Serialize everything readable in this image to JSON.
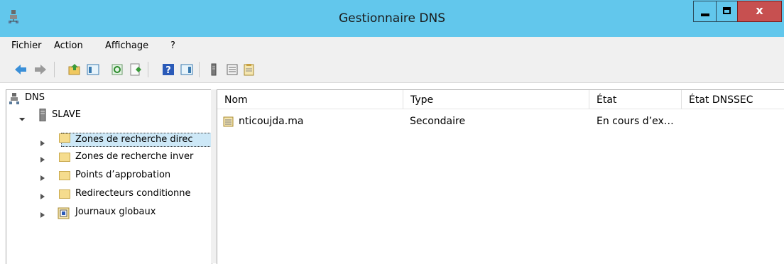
{
  "window": {
    "title": "Gestionnaire DNS",
    "close_glyph": "x"
  },
  "menu": {
    "items": [
      "Fichier",
      "Action",
      "Affichage",
      "?"
    ]
  },
  "tree": {
    "root": "DNS",
    "server": "SLAVE",
    "children": [
      "Zones de recherche direc",
      "Zones de recherche inver",
      "Points d’approbation",
      "Redirecteurs conditionne",
      "Journaux globaux"
    ]
  },
  "list": {
    "columns": [
      "Nom",
      "Type",
      "État",
      "État DNSSEC"
    ],
    "rows": [
      {
        "name": "nticoujda.ma",
        "type": "Secondaire",
        "state": "En cours d’ex…",
        "dnssec": ""
      }
    ]
  },
  "colors": {
    "titlebar": "#62c7ec",
    "close": "#c75050",
    "selection": "#cde8f7"
  },
  "icons": {
    "app": "dns-server-icon",
    "toolbar": [
      "back-arrow-icon",
      "forward-arrow-icon",
      "up-folder-icon",
      "console-tree-icon",
      "refresh-icon",
      "export-list-icon",
      "help-icon",
      "action-pane-icon",
      "server-icon",
      "list-icon",
      "properties-icon"
    ]
  }
}
